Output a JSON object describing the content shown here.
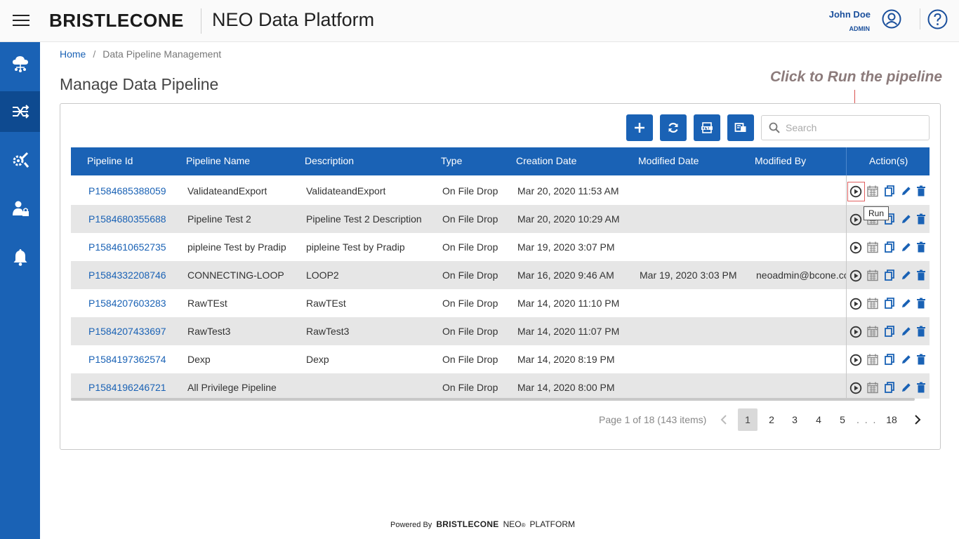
{
  "header": {
    "brand": "BRISTLECONE",
    "product": "NEO Data Platform",
    "user_name": "John Doe",
    "user_role": "ADMIN"
  },
  "sidebar": {
    "items": [
      {
        "icon": "cloud-network-icon"
      },
      {
        "icon": "pipeline-shuffle-icon",
        "active": true
      },
      {
        "icon": "tools-icon"
      },
      {
        "icon": "user-admin-icon"
      },
      {
        "icon": "bell-icon"
      }
    ]
  },
  "breadcrumb": {
    "home": "Home",
    "separator": "/",
    "current": "Data Pipeline Management"
  },
  "page_title": "Manage Data Pipeline",
  "annotation": "Click to Run the pipeline",
  "toolbar": {
    "search_placeholder": "Search"
  },
  "table": {
    "headers": {
      "id": "Pipeline Id",
      "name": "Pipeline Name",
      "description": "Description",
      "type": "Type",
      "created": "Creation Date",
      "modified": "Modified Date",
      "modified_by": "Modified By",
      "actions": "Action(s)"
    },
    "rows": [
      {
        "id": "P1584685388059",
        "name": "ValidateandExport",
        "description": "ValidateandExport",
        "type": "On File Drop",
        "created": "Mar 20, 2020 11:53 AM",
        "modified": "",
        "modified_by": ""
      },
      {
        "id": "P1584680355688",
        "name": "Pipeline Test 2",
        "description": "Pipeline Test 2 Description",
        "type": "On File Drop",
        "created": "Mar 20, 2020 10:29 AM",
        "modified": "",
        "modified_by": ""
      },
      {
        "id": "P1584610652735",
        "name": "pipleine Test by Pradip",
        "description": "pipleine Test by Pradip",
        "type": "On File Drop",
        "created": "Mar 19, 2020 3:07 PM",
        "modified": "",
        "modified_by": ""
      },
      {
        "id": "P1584332208746",
        "name": "CONNECTING-LOOP",
        "description": "LOOP2",
        "type": "On File Drop",
        "created": "Mar 16, 2020 9:46 AM",
        "modified": "Mar 19, 2020 3:03 PM",
        "modified_by": "neoadmin@bcone.co"
      },
      {
        "id": "P1584207603283",
        "name": "RawTEst",
        "description": "RawTEst",
        "type": "On File Drop",
        "created": "Mar 14, 2020 11:10 PM",
        "modified": "",
        "modified_by": ""
      },
      {
        "id": "P1584207433697",
        "name": "RawTest3",
        "description": "RawTest3",
        "type": "On File Drop",
        "created": "Mar 14, 2020 11:07 PM",
        "modified": "",
        "modified_by": ""
      },
      {
        "id": "P1584197362574",
        "name": "Dexp",
        "description": "Dexp",
        "type": "On File Drop",
        "created": "Mar 14, 2020 8:19 PM",
        "modified": "",
        "modified_by": ""
      },
      {
        "id": "P1584196246721",
        "name": "All Privilege Pipeline",
        "description": "",
        "type": "On File Drop",
        "created": "Mar 14, 2020 8:00 PM",
        "modified": "",
        "modified_by": ""
      }
    ],
    "tooltip": "Run"
  },
  "pagination": {
    "info": "Page 1 of 18 (143 items)",
    "pages": [
      "1",
      "2",
      "3",
      "4",
      "5"
    ],
    "ellipsis": ". . .",
    "last": "18",
    "current": "1"
  },
  "footer": {
    "powered_by": "Powered By",
    "brand": "BRISTLECONE",
    "neo": "NEO",
    "reg": "®",
    "platform": "PLATFORM"
  },
  "colors": {
    "primary": "#1a62b5",
    "sidebar_active": "#0e4a90",
    "row_alt": "#e6e6e6",
    "annotation": "#8c7b7b",
    "highlight": "#e06060"
  }
}
